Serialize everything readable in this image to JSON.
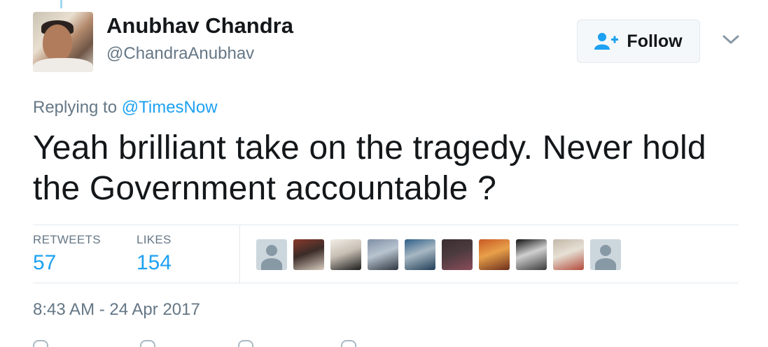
{
  "author": {
    "name": "Anubhav Chandra",
    "handle": "@ChandraAnubhav"
  },
  "follow_button": {
    "label": "Follow",
    "icon": "add-user-icon"
  },
  "reply": {
    "prefix": "Replying to ",
    "mention": "@TimesNow"
  },
  "tweet": {
    "text": "Yeah brilliant take on the tragedy. Never hold the Government accountable ?"
  },
  "stats": {
    "retweets_label": "RETWEETS",
    "retweets_value": "57",
    "likes_label": "LIKES",
    "likes_value": "154"
  },
  "likers": [
    {
      "kind": "default",
      "icon": "default-avatar-icon"
    },
    {
      "kind": "photo",
      "colors": [
        "#8a3a2c",
        "#d9cdc0",
        "#3b2c28"
      ]
    },
    {
      "kind": "photo",
      "colors": [
        "#f2ede6",
        "#1b1b1b",
        "#c7bfb4"
      ]
    },
    {
      "kind": "photo",
      "colors": [
        "#7f8fa6",
        "#2d3540",
        "#b8c4cf"
      ]
    },
    {
      "kind": "photo",
      "colors": [
        "#2f5f88",
        "#1f3d57",
        "#a7b8c3"
      ]
    },
    {
      "kind": "photo",
      "colors": [
        "#3a2e30",
        "#8a4c5a",
        "#4c3b3e"
      ]
    },
    {
      "kind": "photo",
      "colors": [
        "#c85a24",
        "#6b2e1b",
        "#e8a04a"
      ]
    },
    {
      "kind": "photo",
      "colors": [
        "#111111",
        "#3a3a3a",
        "#cfcfcf"
      ]
    },
    {
      "kind": "photo",
      "colors": [
        "#c3b8a8",
        "#b24a3a",
        "#e6e0d4"
      ]
    },
    {
      "kind": "default",
      "icon": "default-avatar-icon"
    }
  ],
  "timestamp": "8:43 AM - 24 Apr 2017",
  "colors": {
    "accent": "#1da1f2",
    "text": "#14171a",
    "muted": "#657786",
    "divider": "#e1e8ed"
  }
}
